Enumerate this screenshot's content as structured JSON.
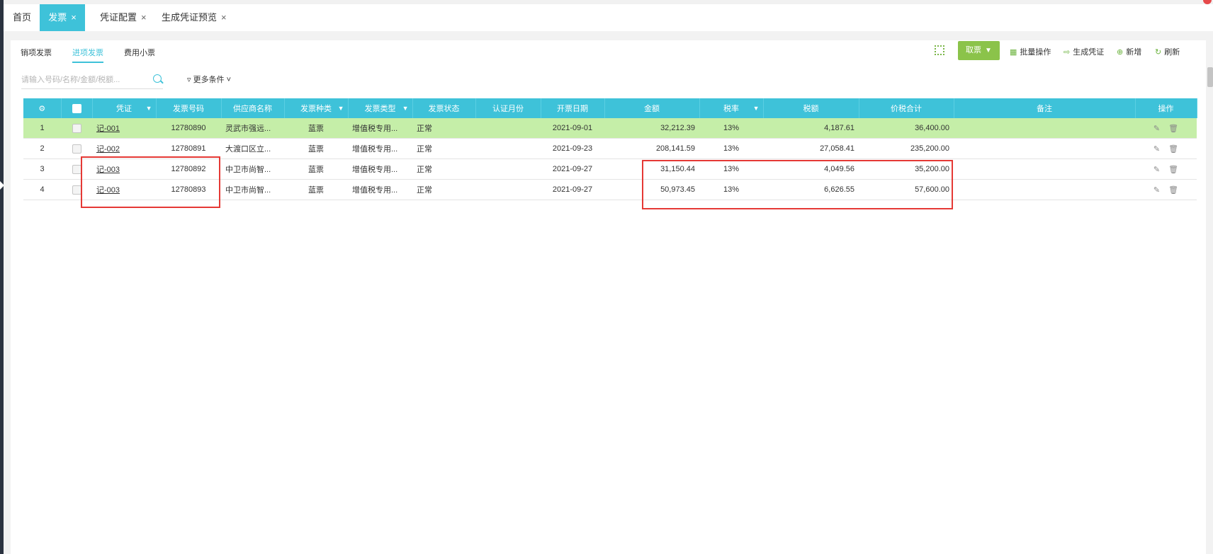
{
  "page_tabs": [
    {
      "label": "首页",
      "closable": false,
      "active": false
    },
    {
      "label": "发票",
      "closable": true,
      "active": true
    },
    {
      "label": "凭证配置",
      "closable": true,
      "active": false
    },
    {
      "label": "生成凭证预览",
      "closable": true,
      "active": false
    }
  ],
  "close_glyph": "×",
  "sub_tabs": [
    "销项发票",
    "进项发票",
    "费用小票"
  ],
  "active_sub_tab": "进项发票",
  "toolbar": {
    "take_ticket": "取票",
    "batch": "批量操作",
    "gen_voucher": "生成凭证",
    "add": "新增",
    "refresh": "刷新"
  },
  "search": {
    "placeholder": "请输入号码/名称/金额/税额..."
  },
  "more_conditions": "更多条件",
  "table": {
    "columns": [
      "凭证",
      "发票号码",
      "供应商名称",
      "发票种类",
      "发票类型",
      "发票状态",
      "认证月份",
      "开票日期",
      "金额",
      "税率",
      "税额",
      "价税合计",
      "备注",
      "操作"
    ],
    "rows": [
      {
        "no": "1",
        "voucher": "记-001",
        "invoice_no": "12780890",
        "supplier": "灵武市强远...",
        "kind": "蓝票",
        "type": "增值税专用...",
        "status": "正常",
        "cert_month": "",
        "date": "2021-09-01",
        "amount": "32,212.39",
        "rate": "13%",
        "tax": "4,187.61",
        "total": "36,400.00",
        "remark": ""
      },
      {
        "no": "2",
        "voucher": "记-002",
        "invoice_no": "12780891",
        "supplier": "大渡口区立...",
        "kind": "蓝票",
        "type": "增值税专用...",
        "status": "正常",
        "cert_month": "",
        "date": "2021-09-23",
        "amount": "208,141.59",
        "rate": "13%",
        "tax": "27,058.41",
        "total": "235,200.00",
        "remark": ""
      },
      {
        "no": "3",
        "voucher": "记-003",
        "invoice_no": "12780892",
        "supplier": "中卫市尚智...",
        "kind": "蓝票",
        "type": "增值税专用...",
        "status": "正常",
        "cert_month": "",
        "date": "2021-09-27",
        "amount": "31,150.44",
        "rate": "13%",
        "tax": "4,049.56",
        "total": "35,200.00",
        "remark": ""
      },
      {
        "no": "4",
        "voucher": "记-003",
        "invoice_no": "12780893",
        "supplier": "中卫市尚智...",
        "kind": "蓝票",
        "type": "增值税专用...",
        "status": "正常",
        "cert_month": "",
        "date": "2021-09-27",
        "amount": "50,973.45",
        "rate": "13%",
        "tax": "6,626.55",
        "total": "57,600.00",
        "remark": ""
      }
    ]
  },
  "colors": {
    "accent": "#3ec2d9",
    "highlight_row": "#c5eea8",
    "green_button": "#8bc34a",
    "annotation_red": "#e53935"
  }
}
